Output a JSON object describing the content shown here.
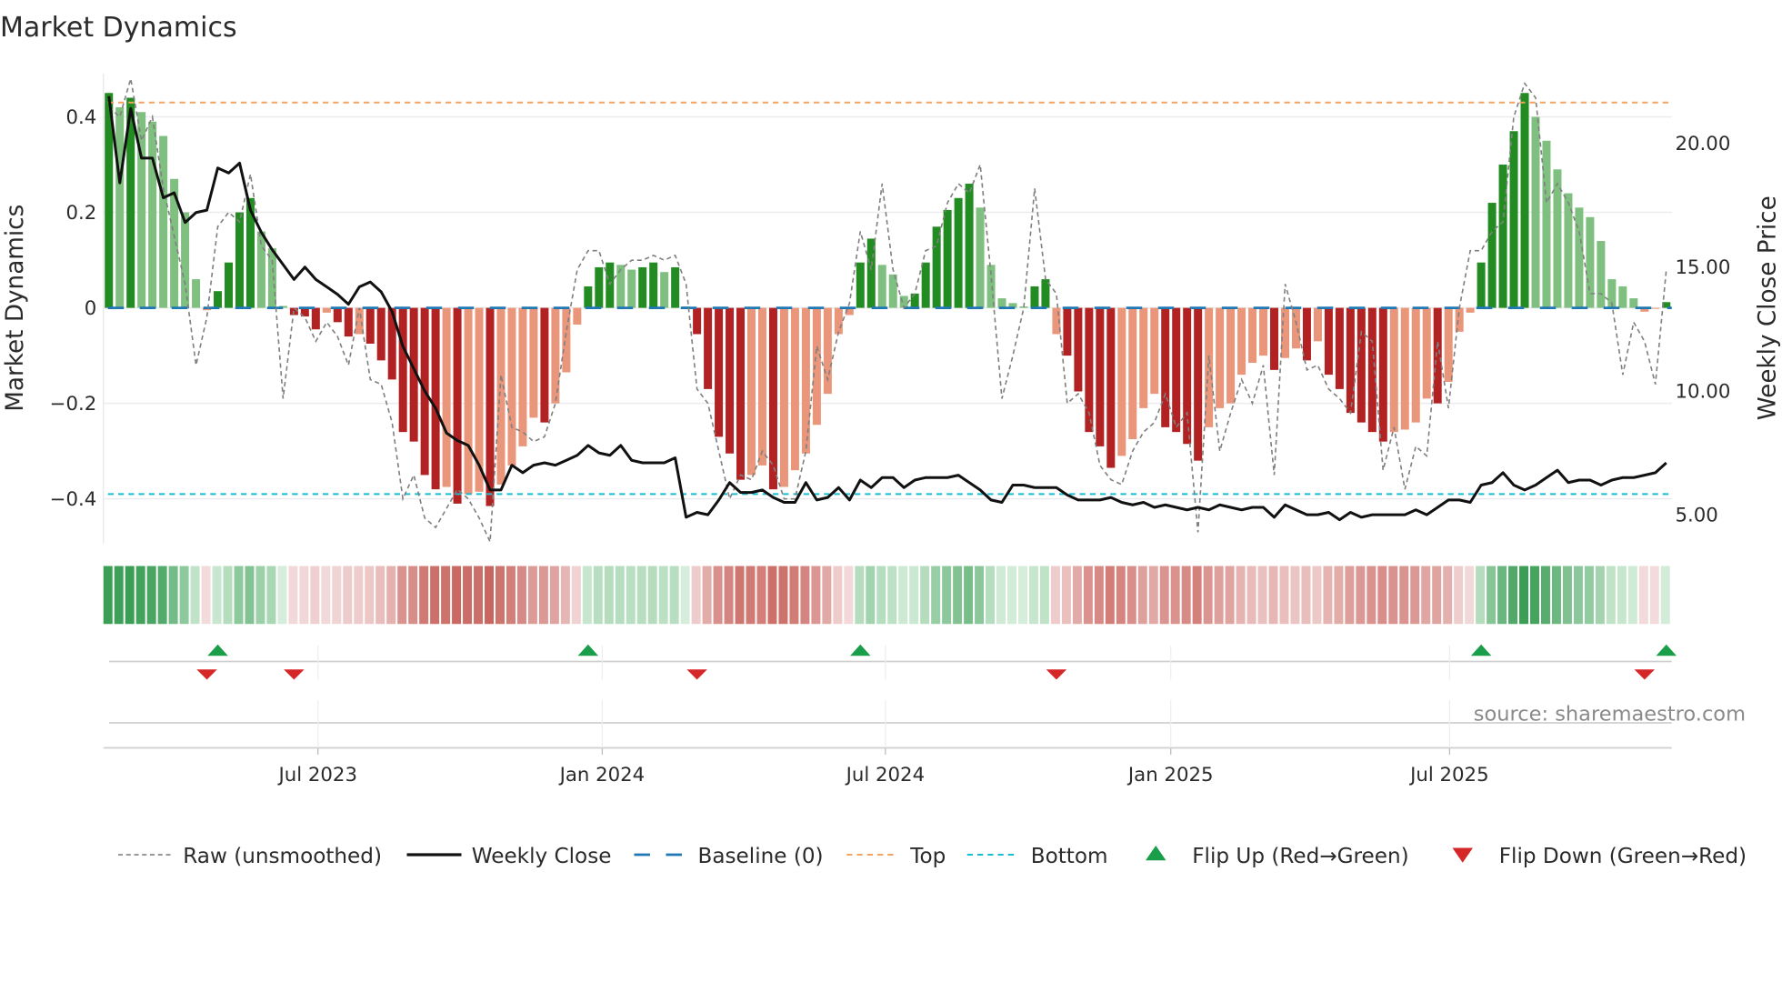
{
  "title": "Market Dynamics",
  "source": "source: sharemaestro.com",
  "colors": {
    "bar_dark_green": "#228b22",
    "bar_light_green": "#7fbf7f",
    "bar_dark_red": "#b22222",
    "bar_light_red": "#e9967a",
    "raw": "#808080",
    "close": "#111111",
    "baseline": "#1f77b4",
    "top": "#f4a460",
    "bottom": "#17becf",
    "flip_up": "#1a9e4a",
    "flip_down": "#d62728"
  },
  "legend": [
    {
      "key": "raw",
      "label": "Raw (unsmoothed)"
    },
    {
      "key": "close",
      "label": "Weekly Close"
    },
    {
      "key": "baseline",
      "label": "Baseline (0)"
    },
    {
      "key": "top",
      "label": "Top"
    },
    {
      "key": "bottom",
      "label": "Bottom"
    },
    {
      "key": "flip_up",
      "label": "Flip Up (Red→Green)"
    },
    {
      "key": "flip_down",
      "label": "Flip Down (Green→Red)"
    }
  ],
  "chart_data": {
    "type": "bar",
    "title": "Market Dynamics",
    "ylabel": "Market Dynamics",
    "y2label": "Weekly Close Price",
    "ylim": [
      -0.493,
      0.49
    ],
    "y2lim": [
      3.85,
      22.8
    ],
    "yticks": [
      {
        "v": 0.4,
        "label": "0.4"
      },
      {
        "v": 0.2,
        "label": "0.2"
      },
      {
        "v": 0,
        "label": "0"
      },
      {
        "v": -0.2,
        "label": "−0.2"
      },
      {
        "v": -0.4,
        "label": "−0.4"
      }
    ],
    "y2ticks": [
      {
        "v": 20,
        "label": "20.00"
      },
      {
        "v": 15,
        "label": "15.00"
      },
      {
        "v": 10,
        "label": "10.00"
      },
      {
        "v": 5,
        "label": "5.00"
      }
    ],
    "xticks": [
      {
        "week": 19.7,
        "label": "Jul 2023"
      },
      {
        "week": 45.8,
        "label": "Jan 2024"
      },
      {
        "week": 71.8,
        "label": "Jul 2024"
      },
      {
        "week": 98,
        "label": "Jan 2025"
      },
      {
        "week": 123.6,
        "label": "Jul 2025"
      }
    ],
    "top_level": 0.43,
    "bottom_level": -0.39,
    "baseline": 0,
    "momentum": [
      0.45,
      0.42,
      0.44,
      0.41,
      0.39,
      0.36,
      0.27,
      0.2,
      0.06,
      -0.005,
      0.035,
      0.095,
      0.2,
      0.23,
      0.16,
      0.125,
      0.004,
      -0.015,
      -0.018,
      -0.045,
      -0.01,
      -0.03,
      -0.06,
      -0.055,
      -0.075,
      -0.11,
      -0.15,
      -0.26,
      -0.28,
      -0.35,
      -0.38,
      -0.375,
      -0.41,
      -0.39,
      -0.385,
      -0.415,
      -0.37,
      -0.33,
      -0.29,
      -0.23,
      -0.24,
      -0.2,
      -0.135,
      -0.035,
      0.045,
      0.085,
      0.095,
      0.09,
      0.08,
      0.085,
      0.095,
      0.075,
      0.085,
      0.003,
      -0.055,
      -0.17,
      -0.27,
      -0.305,
      -0.36,
      -0.35,
      -0.33,
      -0.38,
      -0.375,
      -0.34,
      -0.305,
      -0.245,
      -0.18,
      -0.055,
      -0.015,
      0.095,
      0.145,
      0.09,
      0.07,
      0.025,
      0.03,
      0.095,
      0.17,
      0.205,
      0.23,
      0.26,
      0.21,
      0.09,
      0.02,
      0.01,
      0.003,
      0.045,
      0.06,
      -0.055,
      -0.1,
      -0.175,
      -0.26,
      -0.29,
      -0.335,
      -0.31,
      -0.275,
      -0.21,
      -0.18,
      -0.25,
      -0.26,
      -0.285,
      -0.32,
      -0.25,
      -0.21,
      -0.2,
      -0.14,
      -0.115,
      -0.1,
      -0.13,
      -0.105,
      -0.085,
      -0.11,
      -0.07,
      -0.14,
      -0.17,
      -0.22,
      -0.24,
      -0.26,
      -0.28,
      -0.26,
      -0.255,
      -0.24,
      -0.19,
      -0.2,
      -0.155,
      -0.05,
      -0.01,
      0.095,
      0.22,
      0.3,
      0.37,
      0.45,
      0.4,
      0.35,
      0.29,
      0.24,
      0.21,
      0.19,
      0.14,
      0.06,
      0.045,
      0.02,
      -0.008,
      -0.002,
      0.012
    ],
    "raw": [
      0.42,
      0.4,
      0.48,
      0.35,
      0.4,
      0.25,
      0.15,
      0.05,
      -0.12,
      -0.02,
      0.17,
      0.2,
      0.18,
      0.28,
      0.13,
      0.1,
      -0.19,
      0.0,
      -0.02,
      -0.07,
      -0.03,
      -0.06,
      -0.12,
      0.0,
      -0.15,
      -0.16,
      -0.24,
      -0.4,
      -0.35,
      -0.44,
      -0.46,
      -0.42,
      -0.38,
      -0.4,
      -0.44,
      -0.49,
      -0.14,
      -0.25,
      -0.26,
      -0.28,
      -0.27,
      -0.2,
      -0.05,
      0.08,
      0.12,
      0.12,
      0.05,
      0.08,
      0.1,
      0.1,
      0.11,
      0.1,
      0.11,
      0.05,
      -0.17,
      -0.2,
      -0.3,
      -0.4,
      -0.35,
      -0.36,
      -0.3,
      -0.33,
      -0.4,
      -0.4,
      -0.3,
      -0.08,
      -0.15,
      -0.05,
      0.01,
      0.16,
      0.08,
      0.26,
      0.08,
      0.0,
      0.03,
      0.12,
      0.13,
      0.22,
      0.26,
      0.24,
      0.3,
      0.07,
      -0.19,
      -0.1,
      0.0,
      0.25,
      0.06,
      0.03,
      -0.2,
      -0.18,
      -0.22,
      -0.33,
      -0.36,
      -0.37,
      -0.3,
      -0.26,
      -0.24,
      -0.18,
      -0.25,
      -0.22,
      -0.47,
      -0.1,
      -0.3,
      -0.22,
      -0.15,
      -0.2,
      -0.12,
      -0.35,
      0.05,
      -0.03,
      -0.13,
      -0.12,
      -0.17,
      -0.19,
      -0.22,
      -0.05,
      -0.07,
      -0.34,
      -0.25,
      -0.38,
      -0.29,
      -0.31,
      -0.07,
      -0.21,
      0.0,
      0.12,
      0.12,
      0.16,
      0.18,
      0.4,
      0.47,
      0.44,
      0.22,
      0.26,
      0.22,
      0.16,
      0.03,
      0.03,
      0.01,
      -0.14,
      -0.03,
      -0.07,
      -0.16,
      0.08
    ],
    "close": [
      21.9,
      18.4,
      21.4,
      19.4,
      19.4,
      17.8,
      18.0,
      16.8,
      17.2,
      17.3,
      19.0,
      18.8,
      19.2,
      17.3,
      16.4,
      15.7,
      15.1,
      14.5,
      15.0,
      14.5,
      14.2,
      13.9,
      13.5,
      14.2,
      14.4,
      14.0,
      13.2,
      11.8,
      10.9,
      10.0,
      9.3,
      8.3,
      8.0,
      7.8,
      7.0,
      6.0,
      6.0,
      7.0,
      6.7,
      7.0,
      7.1,
      7.0,
      7.2,
      7.4,
      7.8,
      7.5,
      7.4,
      7.8,
      7.2,
      7.1,
      7.1,
      7.1,
      7.3,
      4.9,
      5.1,
      5.0,
      5.6,
      6.3,
      5.9,
      5.9,
      6.0,
      5.7,
      5.5,
      5.5,
      6.3,
      5.6,
      5.7,
      6.1,
      5.6,
      6.4,
      6.1,
      6.5,
      6.5,
      6.1,
      6.4,
      6.5,
      6.5,
      6.5,
      6.6,
      6.3,
      6.0,
      5.6,
      5.5,
      6.2,
      6.2,
      6.1,
      6.1,
      6.1,
      5.8,
      5.6,
      5.6,
      5.6,
      5.7,
      5.5,
      5.4,
      5.5,
      5.3,
      5.4,
      5.3,
      5.2,
      5.3,
      5.2,
      5.4,
      5.3,
      5.2,
      5.3,
      5.3,
      4.9,
      5.4,
      5.2,
      5.0,
      5.0,
      5.1,
      4.8,
      5.1,
      4.9,
      5.0,
      5.0,
      5.0,
      5.0,
      5.2,
      5.0,
      5.3,
      5.6,
      5.6,
      5.5,
      6.2,
      6.3,
      6.7,
      6.2,
      6.0,
      6.2,
      6.5,
      6.8,
      6.3,
      6.4,
      6.4,
      6.2,
      6.4,
      6.5,
      6.5,
      6.6,
      6.7,
      7.1
    ]
  }
}
